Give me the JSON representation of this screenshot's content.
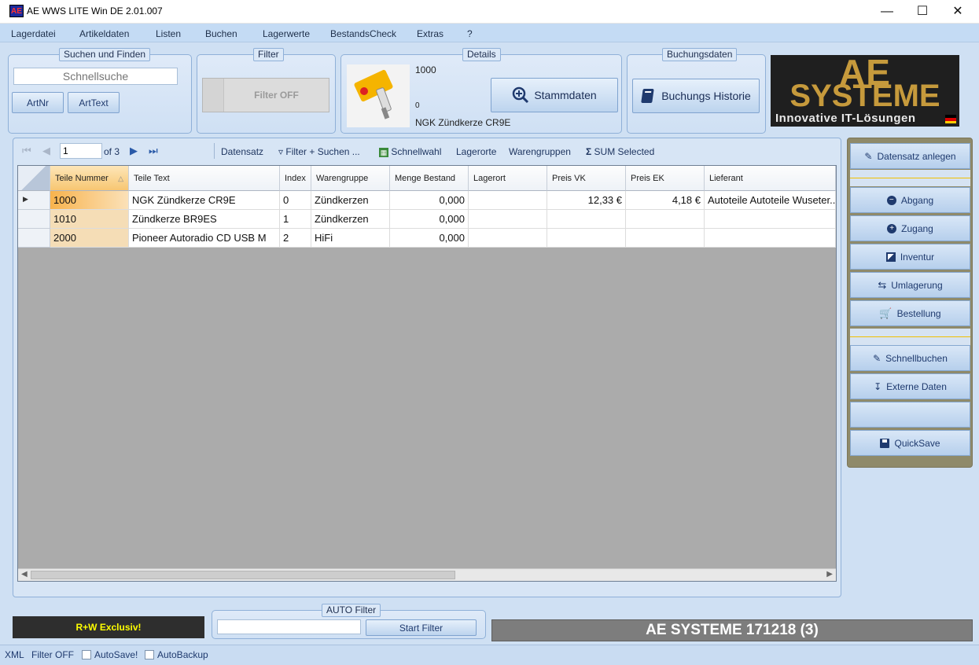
{
  "window": {
    "title": "AE WWS LITE Win DE 2.01.007",
    "icon_text": "AE"
  },
  "menu": [
    "Lagerdatei",
    "Artikeldaten",
    "Listen",
    "Buchen",
    "Lagerwerte",
    "BestandsCheck",
    "Extras",
    "?"
  ],
  "search_group": {
    "title": "Suchen und Finden",
    "placeholder": "Schnellsuche",
    "btn_artnr": "ArtNr",
    "btn_arttext": "ArtText"
  },
  "filter_group": {
    "title": "Filter",
    "button": "Filter OFF"
  },
  "details_group": {
    "title": "Details",
    "line1": "1000",
    "line2": "0",
    "product": "NGK Zündkerze CR9E",
    "btn": "Stammdaten"
  },
  "booking_group": {
    "title": "Buchungsdaten",
    "btn": "Buchungs Historie"
  },
  "logo": {
    "line1": "AE",
    "line2": "SYSTEME",
    "tagline": "Innovative IT-Lösungen"
  },
  "navbar": {
    "position": "1",
    "of_label": "of 3",
    "items": [
      "Datensatz",
      "Filter + Suchen ...",
      "Schnellwahl",
      "Lagerorte",
      "Warengruppen",
      "SUM Selected"
    ]
  },
  "grid": {
    "columns": [
      "Teile Nummer",
      "Teile Text",
      "Index",
      "Warengruppe",
      "Menge Bestand",
      "Lagerort",
      "Preis VK",
      "Preis EK",
      "Lieferant"
    ],
    "rows": [
      [
        "1000",
        "NGK Zündkerze CR9E",
        "0",
        "Zündkerzen",
        "0,000",
        "",
        "12,33 €",
        "4,18 €",
        "Autoteile Autoteile Wuseter..."
      ],
      [
        "1010",
        "Zündkerze BR9ES",
        "1",
        "Zündkerzen",
        "0,000",
        "",
        "",
        "",
        ""
      ],
      [
        "2000",
        "Pioneer Autoradio CD USB M",
        "2",
        "HiFi",
        "0,000",
        "",
        "",
        "",
        ""
      ]
    ]
  },
  "side_panel": {
    "btn_new": "Datensatz anlegen",
    "btn_abgang": "Abgang",
    "btn_zugang": "Zugang",
    "btn_inventur": "Inventur",
    "btn_umlagerung": "Umlagerung",
    "btn_bestellung": "Bestellung",
    "btn_schnellbuchen": "Schnellbuchen",
    "btn_externe": "Externe Daten",
    "btn_quicksave": "QuickSave"
  },
  "bottom": {
    "exclusive": "R+W Exclusiv!",
    "auto_filter_title": "AUTO Filter",
    "start_filter": "Start Filter",
    "banner": "AE SYSTEME 171218 (3)"
  },
  "statusbar": {
    "xml": "XML",
    "filter": "Filter OFF",
    "autosave": "AutoSave!",
    "autobackup": "AutoBackup"
  },
  "colors": {
    "key_column": "#f5ddb6",
    "banner": "#7d7d7d",
    "exclusive_text": "#ffff00",
    "side_panel": "#8f8a6a"
  }
}
